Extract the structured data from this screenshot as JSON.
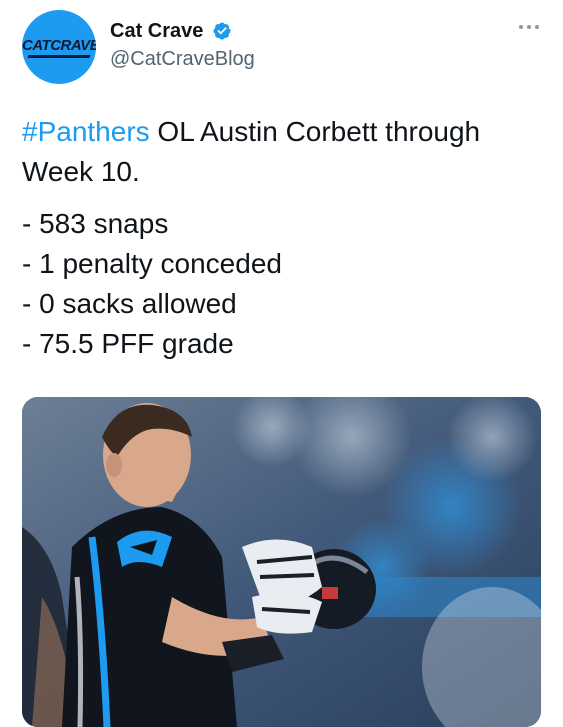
{
  "account": {
    "display_name": "Cat Crave",
    "handle": "@CatCraveBlog",
    "avatar_text": "CATCRAVE",
    "verified": true
  },
  "tweet": {
    "hashtag": "#Panthers",
    "headline_rest": " OL Austin Corbett through Week 10.",
    "stats": [
      "- 583 snaps",
      "- 1 penalty conceded",
      "- 0 sacks allowed",
      "- 75.5 PFF grade"
    ]
  },
  "colors": {
    "link": "#1d9bf0",
    "text": "#0f1419",
    "muted": "#536471",
    "verified_badge": "#1d9bf0"
  },
  "icons": {
    "verified": "verified-badge-icon",
    "more": "more-dots-icon"
  }
}
